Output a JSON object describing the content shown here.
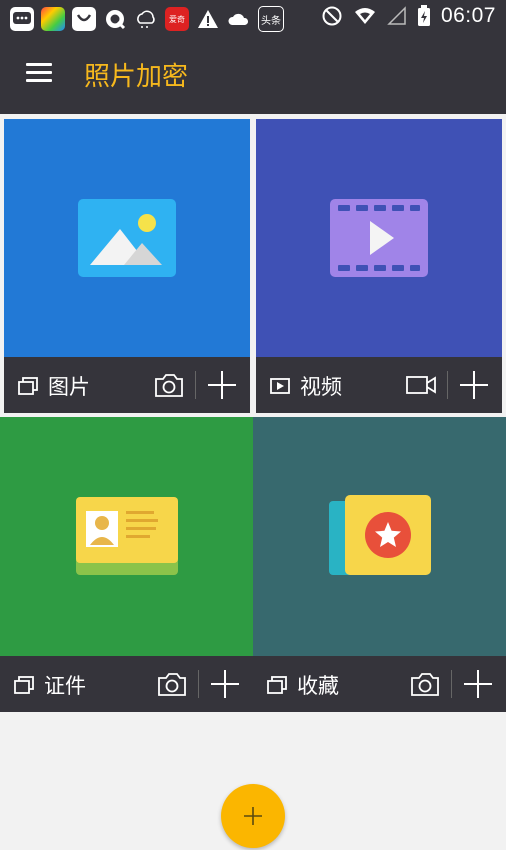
{
  "status_bar": {
    "time": "06:07",
    "notification_icons": [
      "message-icon",
      "gallery-app-icon",
      "shopping-icon",
      "q-app-icon",
      "cloud-icon",
      "news-app-icon",
      "warning-icon",
      "weather-icon",
      "toutiao-icon"
    ],
    "news_app_text": "头条",
    "red_app_text": "爱奇"
  },
  "app_bar": {
    "title": "照片加密"
  },
  "tiles": [
    {
      "label": "图片",
      "color": "#2279d6"
    },
    {
      "label": "视频",
      "color": "#3f51b5"
    },
    {
      "label": "证件",
      "color": "#2e9b43"
    },
    {
      "label": "收藏",
      "color": "#37696e"
    }
  ],
  "colors": {
    "bar": "#35343b",
    "accent": "#f6b81d",
    "fab": "#fbb600"
  }
}
